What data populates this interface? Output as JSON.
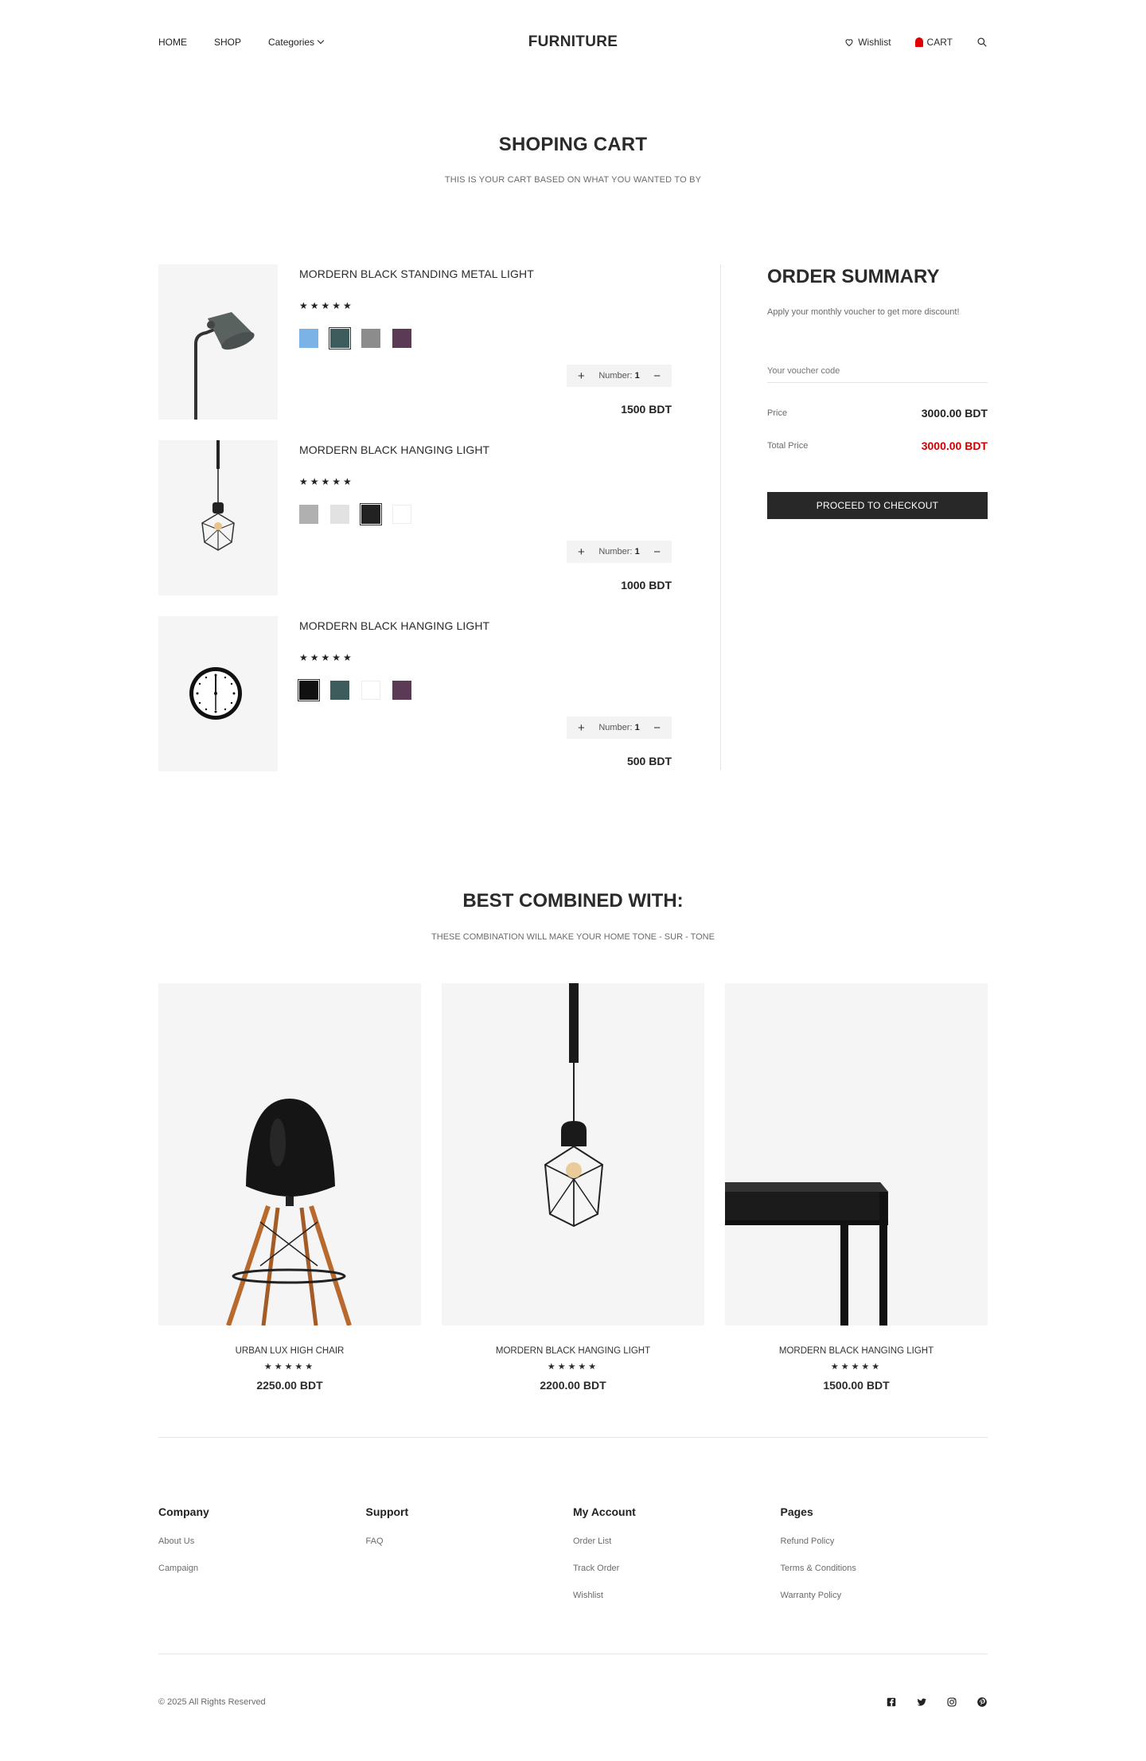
{
  "header": {
    "nav": {
      "home": "HOME",
      "shop": "SHOP",
      "categories": "Categories"
    },
    "logo": "FURNITURE",
    "wishlist": "Wishlist",
    "cart": "CART"
  },
  "page": {
    "title": "SHOPING CART",
    "subtitle": "THIS IS YOUR CART BASED ON WHAT YOU WANTED TO BY"
  },
  "cart": {
    "items": [
      {
        "name": "MORDERN BLACK STANDING METAL LIGHT",
        "stars": "★★★★★",
        "swatches": [
          "#7bb3e6",
          "#3e5c5c",
          "#8c8c8c",
          "#5a3a55"
        ],
        "qty_label": "Number:",
        "qty": "1",
        "price": "1500 BDT"
      },
      {
        "name": "MORDERN BLACK HANGING LIGHT",
        "stars": "★★★★★",
        "swatches": [
          "#b0b0b0",
          "#e2e2e2",
          "#222222",
          "#ffffff"
        ],
        "qty_label": "Number:",
        "qty": "1",
        "price": "1000 BDT"
      },
      {
        "name": "MORDERN BLACK HANGING LIGHT",
        "stars": "★★★★★",
        "swatches": [
          "#111111",
          "#3e5c5c",
          "#ffffff",
          "#5a3a55"
        ],
        "qty_label": "Number:",
        "qty": "1",
        "price": "500 BDT"
      }
    ]
  },
  "summary": {
    "title": "ORDER SUMMARY",
    "subtitle": "Apply your monthly voucher to get more discount!",
    "voucher_placeholder": "Your voucher code",
    "price_label": "Price",
    "price_value": "3000.00 BDT",
    "total_label": "Total Price",
    "total_value": "3000.00 BDT",
    "checkout": "PROCEED TO CHECKOUT"
  },
  "combined": {
    "title": "BEST COMBINED WITH:",
    "subtitle": "THESE COMBINATION WILL MAKE YOUR HOME TONE - SUR - TONE",
    "products": [
      {
        "name": "URBAN LUX HIGH CHAIR",
        "stars": "★★★★★",
        "price": "2250.00 BDT"
      },
      {
        "name": "MORDERN BLACK HANGING LIGHT",
        "stars": "★★★★★",
        "price": "2200.00 BDT"
      },
      {
        "name": "MORDERN BLACK HANGING LIGHT",
        "stars": "★★★★★",
        "price": "1500.00 BDT"
      }
    ]
  },
  "footer": {
    "columns": [
      {
        "title": "Company",
        "links": [
          "About Us",
          "Campaign"
        ]
      },
      {
        "title": "Support",
        "links": [
          "FAQ"
        ]
      },
      {
        "title": "My Account",
        "links": [
          "Order List",
          "Track Order",
          "Wishlist"
        ]
      },
      {
        "title": "Pages",
        "links": [
          "Refund Policy",
          "Terms & Conditions",
          "Warranty Policy"
        ]
      }
    ],
    "copyright": "© 2025 All Rights Reserved",
    "social": [
      "facebook-icon",
      "twitter-icon",
      "instagram-icon",
      "pinterest-icon"
    ]
  }
}
